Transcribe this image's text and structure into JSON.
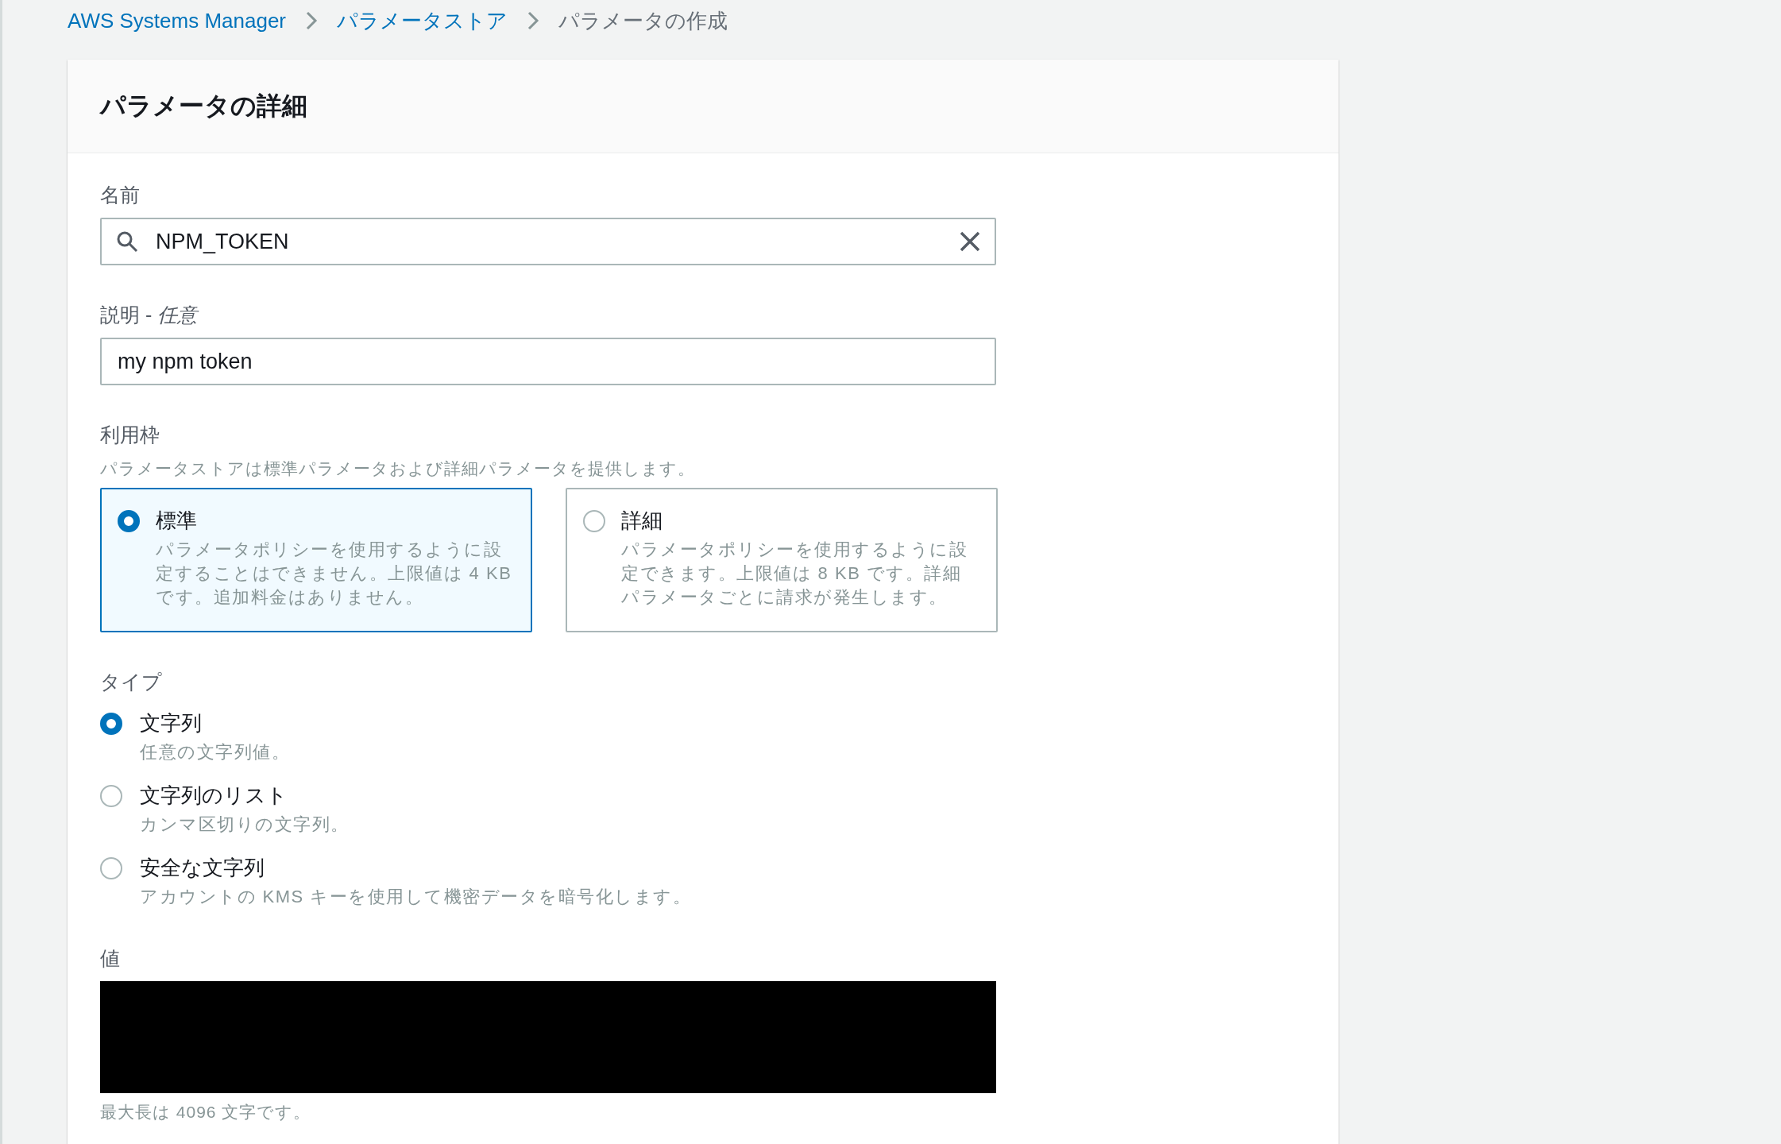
{
  "breadcrumbs": [
    {
      "label": "AWS Systems Manager",
      "link": true
    },
    {
      "label": "パラメータストア",
      "link": true
    },
    {
      "label": "パラメータの作成",
      "link": false
    }
  ],
  "panel": {
    "title": "パラメータの詳細",
    "name_field": {
      "label": "名前",
      "value": "NPM_TOKEN"
    },
    "description_field": {
      "label": "説明 - *任意*",
      "value": "my npm token"
    },
    "tier": {
      "label": "利用枠",
      "hint": "パラメータストアは標準パラメータおよび詳細パラメータを提供します。",
      "options": [
        {
          "title": "標準",
          "description": "パラメータポリシーを使用するように設定することはできません。上限値は 4 KB です。追加料金はありません。",
          "selected": true
        },
        {
          "title": "詳細",
          "description": "パラメータポリシーを使用するように設定できます。上限値は 8 KB です。詳細パラメータごとに請求が発生します。",
          "selected": false
        }
      ]
    },
    "type": {
      "label": "タイプ",
      "options": [
        {
          "title": "文字列",
          "description": "任意の文字列値。",
          "selected": true
        },
        {
          "title": "文字列のリスト",
          "description": "カンマ区切りの文字列。",
          "selected": false
        },
        {
          "title": "安全な文字列",
          "description": "アカウントの KMS キーを使用して機密データを暗号化します。",
          "selected": false
        }
      ]
    },
    "value_field": {
      "label": "値",
      "hint": "最大長は 4096 文字です。"
    }
  }
}
